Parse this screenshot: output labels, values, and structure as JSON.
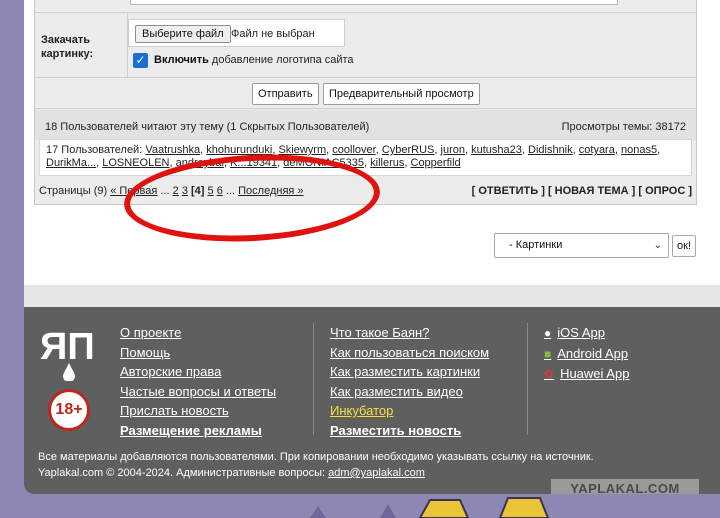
{
  "upload": {
    "label": "Закачать картинку:",
    "choose_button": "Выберите файл",
    "no_file": "Файл не выбран",
    "logo_checkbox_bold": "Включить",
    "logo_checkbox_rest": " добавление логотипа сайта"
  },
  "form_buttons": {
    "submit": "Отправить",
    "preview": "Предварительный просмотр"
  },
  "readers": {
    "text": "18 Пользователей читают эту тему (1 Скрытых Пользователей)",
    "views": "Просмотры темы: 38172",
    "users_prefix": "17 Пользователей: ",
    "users": [
      "Vaatrushka",
      "khohurunduki",
      "Skiewyrm",
      "coollover",
      "CyberRUS",
      "juron",
      "kutusha23",
      "Didishnik",
      "cotyara",
      "nonas5",
      "DurikMa...",
      "LOSNEOLEN",
      "andreybai",
      "K...19341",
      "deMONIAC5335",
      "killerus",
      "Copperfild"
    ]
  },
  "pager": {
    "prefix": "Страницы (9)",
    "first": "« Первая",
    "ellipsis": "...",
    "pages": [
      "2",
      "3"
    ],
    "current": "[4]",
    "pages_after": [
      "5",
      "6"
    ],
    "last": "Последняя »"
  },
  "actions": "[ ОТВЕТИТЬ ] [ НОВАЯ ТЕМА ] [ ОПРОС ]",
  "forum_select": {
    "value": "- Картинки",
    "ok": "ок!"
  },
  "footer": {
    "logo_text": "ЯП",
    "age_badge": "18+",
    "col1": [
      "О проекте",
      "Помощь",
      "Авторские права",
      "Частые вопросы и ответы",
      "Прислать новость",
      "Размещение рекламы"
    ],
    "col2": [
      "Что такое Баян?",
      "Как пользоваться поиском",
      "Как разместить картинки",
      "Как разместить видео",
      "Инкубатор",
      "Разместить новость"
    ],
    "apps": [
      "iOS App",
      "Android App",
      "Huawei App"
    ],
    "note_line1": "Все материалы добавляются пользователями. При копировании необходимо указывать ссылку на источник.",
    "note_line2_prefix": "Yaplakal.com © 2004-2024. Административные вопросы: ",
    "email": "adm@yaplakal.com"
  },
  "watermark": "YAPLAKAL.COM",
  "colors": {
    "footer_bg": "#5f5f5f",
    "link_yellow": "#f5e23a",
    "annotation_red": "#e0120e",
    "checkbox_blue": "#1a6fd6"
  }
}
